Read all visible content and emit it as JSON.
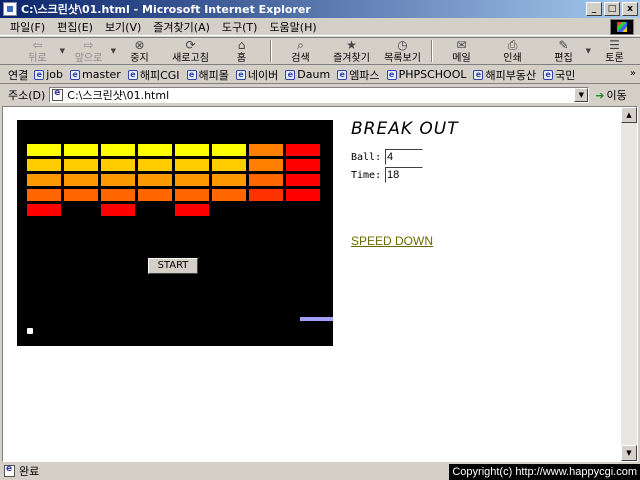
{
  "window": {
    "title": "C:\\스크린샷\\01.html - Microsoft Internet Explorer",
    "buttons": [
      "_",
      "□",
      "x"
    ]
  },
  "menu": [
    "파일(F)",
    "편집(E)",
    "보기(V)",
    "즐겨찾기(A)",
    "도구(T)",
    "도움말(H)"
  ],
  "toolbar": {
    "back": "뒤로",
    "forward": "앞으로",
    "stop": "중지",
    "refresh": "새로고침",
    "home": "홈",
    "search": "검색",
    "favorites": "즐겨찾기",
    "history": "목록보기",
    "mail": "메일",
    "print": "인쇄",
    "edit": "편집",
    "discuss": "토론"
  },
  "links": {
    "label": "연결",
    "items": [
      "job",
      "master",
      "해피CGI",
      "해피몰",
      "네이버",
      "Daum",
      "엠파스",
      "PHPSCHOOL",
      "해피부동산",
      "국민"
    ],
    "more": "»"
  },
  "address": {
    "label": "주소(D)",
    "value": "C:\\스크린샷\\01.html",
    "go": "이동"
  },
  "game": {
    "start_label": "START",
    "bricks": [
      [
        "#ffff00",
        "#ffff00",
        "#ffff00",
        "#ffff00",
        "#ffff00",
        "#ffff00",
        "#ff8000",
        "#ff0000"
      ],
      [
        "#ffcc00",
        "#ffcc00",
        "#ffcc00",
        "#ffcc00",
        "#ffcc00",
        "#ffcc00",
        "#ff8000",
        "#ff0000"
      ],
      [
        "#ff9900",
        "#ff9900",
        "#ff9900",
        "#ff9900",
        "#ff9900",
        "#ff9900",
        "#ff6600",
        "#ff0000"
      ],
      [
        "#ff6600",
        "#ff6600",
        "#ff6600",
        "#ff6600",
        "#ff6600",
        "#ff6600",
        "#ff3300",
        "#ff0000"
      ],
      [
        "#ff0000",
        null,
        "#ff0000",
        null,
        "#ff0000",
        null,
        null,
        null
      ]
    ]
  },
  "side": {
    "title": "BREAK OUT",
    "ball_label": "Ball:",
    "ball_value": "4",
    "time_label": "Time:",
    "time_value": "18",
    "speed_link": "SPEED DOWN"
  },
  "status": {
    "text": "완료",
    "copyright": "Copyright(c) http://www.happycgi.com"
  }
}
